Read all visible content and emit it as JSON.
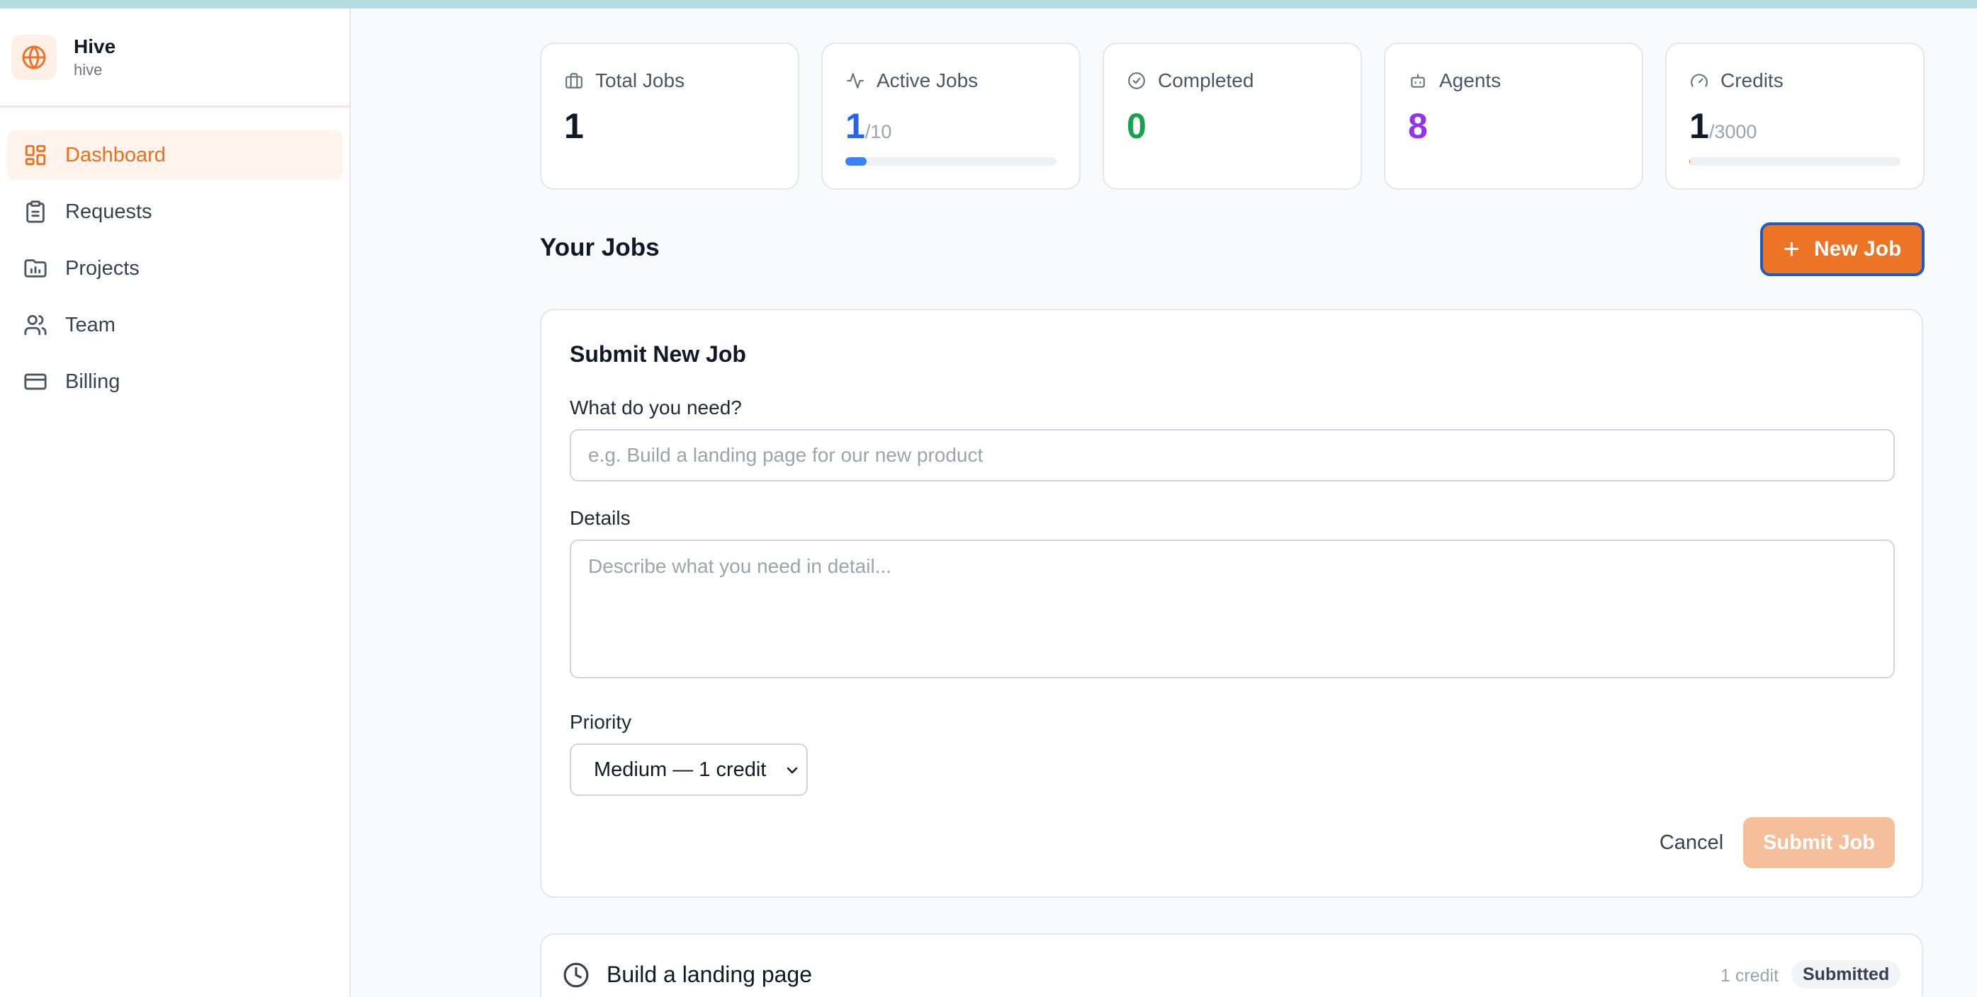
{
  "brand": {
    "name": "Hive",
    "slug": "hive"
  },
  "nav": [
    {
      "label": "Dashboard",
      "icon": "dashboard-icon",
      "active": true
    },
    {
      "label": "Requests",
      "icon": "clipboard-icon",
      "active": false
    },
    {
      "label": "Projects",
      "icon": "folder-chart-icon",
      "active": false
    },
    {
      "label": "Team",
      "icon": "users-icon",
      "active": false
    },
    {
      "label": "Billing",
      "icon": "credit-card-icon",
      "active": false
    }
  ],
  "stats": {
    "total_jobs": {
      "label": "Total Jobs",
      "value": "1",
      "icon": "briefcase-icon"
    },
    "active_jobs": {
      "label": "Active Jobs",
      "value": "1",
      "denom": "/10",
      "progress": 0.1,
      "icon": "activity-icon"
    },
    "completed": {
      "label": "Completed",
      "value": "0",
      "icon": "check-circle-icon"
    },
    "agents": {
      "label": "Agents",
      "value": "8",
      "icon": "bot-icon"
    },
    "credits": {
      "label": "Credits",
      "value": "1",
      "denom": "/3000",
      "progress": 0.0003,
      "icon": "gauge-icon"
    }
  },
  "jobs_section": {
    "title": "Your Jobs",
    "new_job_label": "New Job"
  },
  "form": {
    "title": "Submit New Job",
    "need_label": "What do you need?",
    "need_placeholder": "e.g. Build a landing page for our new product",
    "details_label": "Details",
    "details_placeholder": "Describe what you need in detail...",
    "priority_label": "Priority",
    "priority_value": "Medium — 1 credit",
    "cancel_label": "Cancel",
    "submit_label": "Submit Job"
  },
  "jobs": [
    {
      "title": "Build a landing page",
      "credits": "1 credit",
      "status": "Submitted"
    }
  ],
  "colors": {
    "accent": "#ed7325",
    "active_blue": "#2563eb",
    "completed_green": "#16a34a",
    "agents_purple": "#9333ea"
  }
}
